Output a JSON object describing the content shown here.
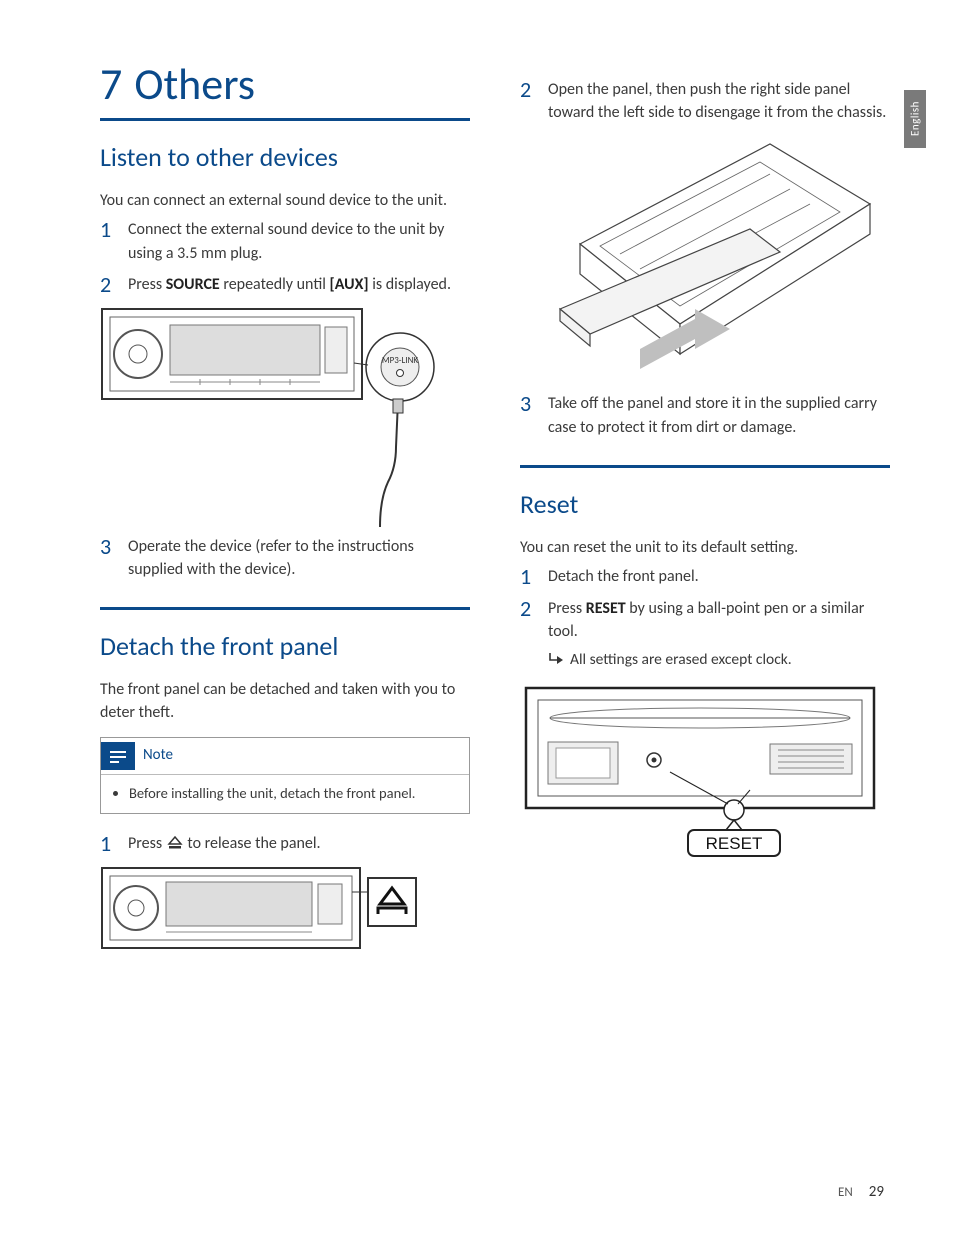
{
  "lang_tab": "English",
  "chapter": {
    "num": "7",
    "title": "Others"
  },
  "section1": {
    "title": "Listen to other devices",
    "intro": "You can connect an external sound device to the unit.",
    "step1": {
      "num": "1",
      "pre": "Connect the external sound device to the unit by using a 3.5 mm plug."
    },
    "step2": {
      "num": "2",
      "pre": "Press ",
      "b1": "SOURCE",
      "mid": " repeatedly until ",
      "b2": "[AUX]",
      "post": " is displayed."
    },
    "fig_label": "MP3-LINK",
    "step3": {
      "num": "3",
      "text": "Operate the device (refer to the instructions supplied with the device)."
    }
  },
  "section2": {
    "title": "Detach the front panel",
    "intro": "The front panel can be detached and taken with you to deter theft.",
    "note_title": "Note",
    "note_body": "Before installing the unit, detach the front panel.",
    "step1": {
      "num": "1",
      "pre": "Press ",
      "post": " to release the panel."
    }
  },
  "section3": {
    "step2": {
      "num": "2",
      "text": "Open the panel, then push the right side panel toward the left side to disengage it from the chassis."
    },
    "step3": {
      "num": "3",
      "text": "Take off the panel and store it in the supplied carry case to protect it from dirt or damage."
    }
  },
  "section4": {
    "title": "Reset",
    "intro": "You can reset the unit to its default setting.",
    "step1": {
      "num": "1",
      "text": "Detach the front panel."
    },
    "step2": {
      "num": "2",
      "pre": "Press ",
      "b1": "RESET",
      "post": " by using a ball-point pen or a similar tool.",
      "result": "All settings are erased except clock."
    },
    "fig_label": "RESET"
  },
  "footer": {
    "lang": "EN",
    "page": "29"
  }
}
